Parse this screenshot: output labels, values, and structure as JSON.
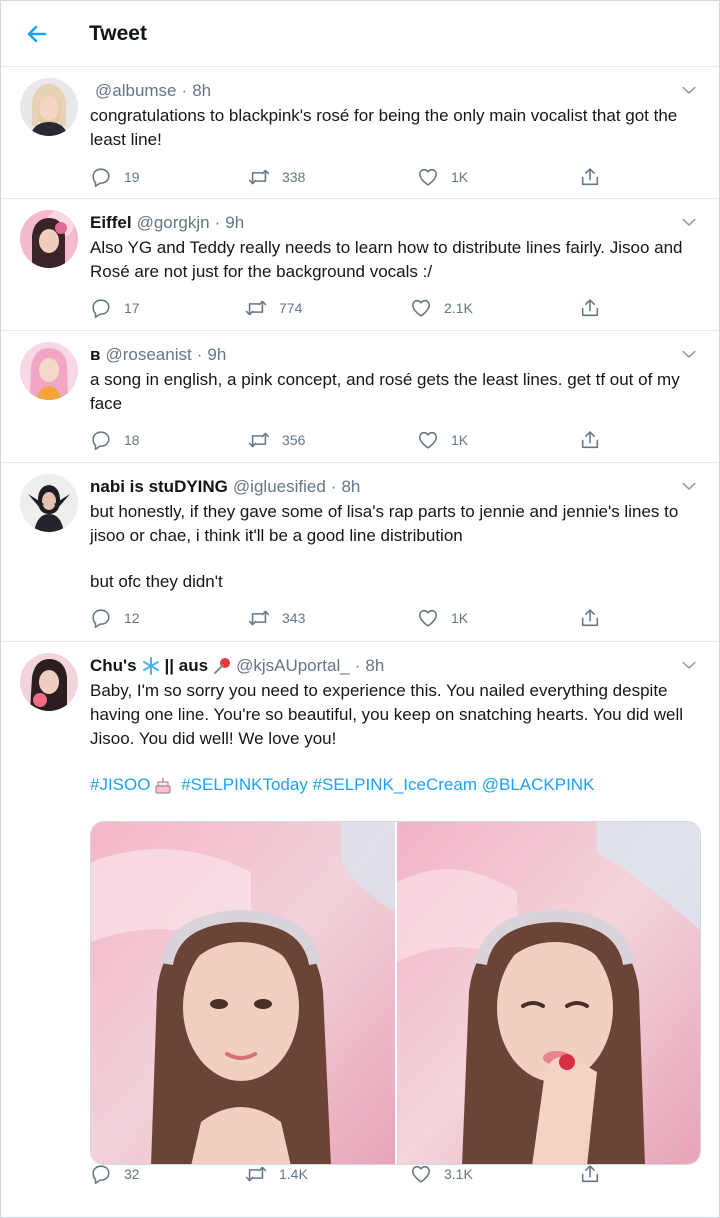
{
  "header": {
    "title": "Tweet",
    "back_icon": "arrow-left-icon",
    "accent": "#1da1f2"
  },
  "tweets": [
    {
      "name": "",
      "handle": "@albumse",
      "time": "8h",
      "text": [
        "congratulations to blackpink's rosé for being the only main vocalist that got the least line!"
      ],
      "replies": "19",
      "retweets": "338",
      "likes": "1K"
    },
    {
      "name": "Eiffel",
      "handle": "@gorgkjn",
      "time": "9h",
      "text": [
        "Also YG and Teddy really needs to learn how to distribute lines fairly. Jisoo and Rosé are not just for the background vocals :/"
      ],
      "replies": "17",
      "retweets": "774",
      "likes": "2.1K"
    },
    {
      "name": "ʙ",
      "handle": "@roseanist",
      "time": "9h",
      "text": [
        "a song in english, a pink concept, and rosé gets the least lines. get tf out of my face"
      ],
      "replies": "18",
      "retweets": "356",
      "likes": "1K"
    },
    {
      "name": "nabi is stuDYING",
      "handle": "@igluesified",
      "time": "8h",
      "text": [
        "but honestly, if they gave some of lisa's rap parts to jennie and jennie's lines to jisoo or chae, i think it'll be a good line distribution",
        "but ofc they didn't"
      ],
      "replies": "12",
      "retweets": "343",
      "likes": "1K"
    },
    {
      "name_part1": "Chu's",
      "name_part2": "|| aus",
      "handle": "@kjsAUportal_",
      "time": "8h",
      "text": [
        "Baby, I'm so sorry you need to experience this. You nailed everything despite having one line. You're so beautiful, you keep on snatching hearts. You did well Jisoo. You did well! We love you!"
      ],
      "hashtags": [
        "#JISOO",
        "#SELPINKToday",
        "#SELPINK_IceCream",
        "@BLACKPINK"
      ],
      "replies": "32",
      "retweets": "1.4K",
      "likes": "3.1K"
    }
  ],
  "icons": [
    "reply-icon",
    "retweet-icon",
    "like-icon",
    "share-icon",
    "caret-down-icon",
    "snowflake-emoji",
    "pushpin-emoji",
    "cake-emoji"
  ]
}
